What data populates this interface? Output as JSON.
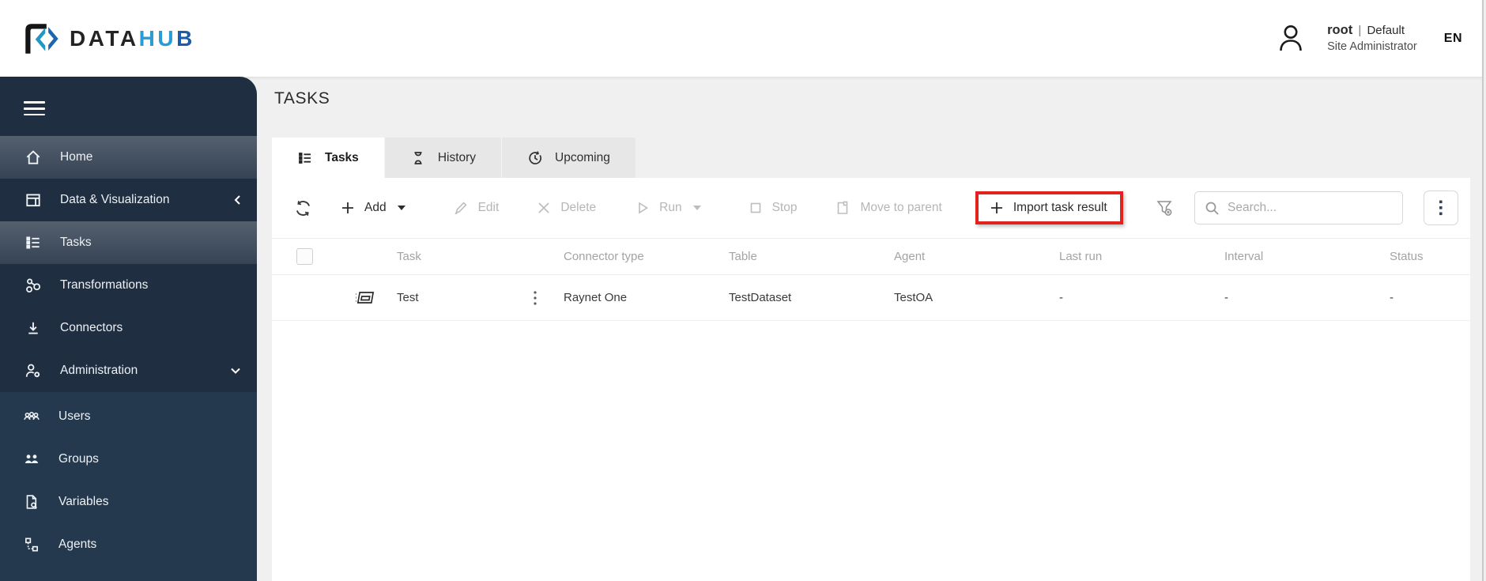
{
  "header": {
    "logo": {
      "icon": "datahub-logo-icon",
      "text_dark": "DATA",
      "text_blue_light": "HU",
      "text_blue_dark": "B"
    },
    "user": {
      "icon": "user-avatar-icon",
      "name": "root",
      "separator": "|",
      "domain": "Default",
      "role": "Site Administrator"
    },
    "language": "EN"
  },
  "colors": {
    "sidebar_bg": "#1f2e41",
    "sidebar_submenu_bg": "#24394e",
    "logo_blue_light": "#2a9bd4",
    "logo_blue_dark": "#1d5da6",
    "annotation_red": "#e0231d",
    "page_bg": "#f0f0f1"
  },
  "sidebar": {
    "menu_icon": "hamburger-icon",
    "items": [
      {
        "label": "Home",
        "icon": "home-icon",
        "highlighted": true
      },
      {
        "label": "Data & Visualization",
        "icon": "data-visualization-icon",
        "chevron": "left"
      },
      {
        "label": "Tasks",
        "icon": "task-list-icon",
        "highlighted": true,
        "selected": true
      },
      {
        "label": "Transformations",
        "icon": "transformations-icon"
      },
      {
        "label": "Connectors",
        "icon": "connectors-icon"
      },
      {
        "label": "Administration",
        "icon": "administration-icon",
        "chevron": "down",
        "expanded": true
      }
    ],
    "submenu_items": [
      {
        "label": "Users",
        "icon": "users-icon"
      },
      {
        "label": "Groups",
        "icon": "groups-icon"
      },
      {
        "label": "Variables",
        "icon": "variables-icon"
      },
      {
        "label": "Agents",
        "icon": "agents-icon"
      }
    ]
  },
  "main": {
    "page_title": "TASKS",
    "tabs": [
      {
        "label": "Tasks",
        "icon": "task-list-icon",
        "active": true
      },
      {
        "label": "History",
        "icon": "hourglass-icon",
        "active": false
      },
      {
        "label": "Upcoming",
        "icon": "upcoming-clock-icon",
        "active": false
      }
    ],
    "toolbar": {
      "refresh_icon": "refresh-icon",
      "buttons": [
        {
          "label": "Add",
          "icon": "plus-icon",
          "enabled": true,
          "has_dropdown": true
        },
        {
          "label": "Edit",
          "icon": "pencil-icon",
          "enabled": false
        },
        {
          "label": "Delete",
          "icon": "x-icon",
          "enabled": false
        },
        {
          "label": "Run",
          "icon": "play-icon",
          "enabled": false,
          "has_dropdown": true
        },
        {
          "label": "Stop",
          "icon": "stop-icon",
          "enabled": false
        },
        {
          "label": "Move to parent",
          "icon": "move-to-parent-icon",
          "enabled": false
        },
        {
          "label": "Import task result",
          "icon": "plus-icon",
          "enabled": true,
          "annotated": true
        }
      ],
      "filter_icon": "filter-clear-icon",
      "search_placeholder": "Search...",
      "more_icon": "kebab-menu-icon"
    },
    "annotation": {
      "type": "red-box",
      "target": "Import task result"
    },
    "table": {
      "columns": [
        "Task",
        "Connector type",
        "Table",
        "Agent",
        "Last run",
        "Interval",
        "Status"
      ],
      "rows": [
        {
          "task": "Test",
          "connector_type": "Raynet One",
          "table": "TestDataset",
          "agent": "TestOA",
          "last_run": "-",
          "interval": "-",
          "status": "-"
        }
      ]
    }
  }
}
